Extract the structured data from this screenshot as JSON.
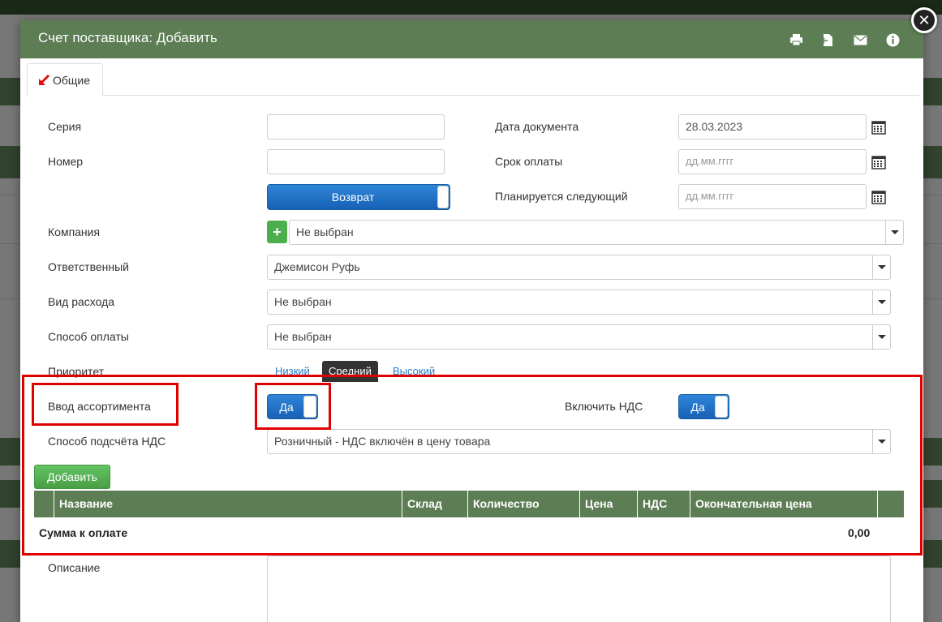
{
  "modal": {
    "title": "Счет поставщика: Добавить",
    "header_icons": [
      "print-icon",
      "export-icon",
      "mail-icon",
      "info-icon"
    ],
    "close_label": "✕"
  },
  "tabs": [
    {
      "label": "Общие",
      "active": true
    }
  ],
  "form": {
    "series": {
      "label": "Серия",
      "value": ""
    },
    "number": {
      "label": "Номер",
      "value": ""
    },
    "return_button": "Возврат",
    "doc_date": {
      "label": "Дата документа",
      "value": "28.03.2023"
    },
    "due_date": {
      "label": "Срок оплаты",
      "placeholder": "дд.мм.гггг"
    },
    "next_planned": {
      "label": "Планируется следующий",
      "placeholder": "дд.мм.гггг"
    },
    "company": {
      "label": "Компания",
      "value": "Не выбран"
    },
    "responsible": {
      "label": "Ответственный",
      "value": "Джемисон Руфь"
    },
    "expense_type": {
      "label": "Вид расхода",
      "value": "Не выбран"
    },
    "payment_method": {
      "label": "Способ оплаты",
      "value": "Не выбран"
    },
    "priority": {
      "label": "Приоритет",
      "options": [
        "Низкий",
        "Средний",
        "Высокий"
      ],
      "selected": "Средний"
    },
    "assortment": {
      "label": "Ввод ассортимента",
      "toggle": "Да"
    },
    "vat_include": {
      "label": "Включить НДС",
      "toggle": "Да"
    },
    "vat_method": {
      "label": "Способ подсчёта НДС",
      "value": "Розничный - НДС включён в цену товара"
    },
    "add_button": "Добавить",
    "description": {
      "label": "Описание",
      "value": ""
    }
  },
  "table": {
    "columns": [
      "Название",
      "Склад",
      "Количество",
      "Цена",
      "НДС",
      "Окончательная цена"
    ],
    "rows": [],
    "total_label": "Сумма к оплате",
    "total_value": "0,00"
  },
  "colors": {
    "header_green": "#5d7d54",
    "toggle_blue": "#1760b5",
    "highlight_red": "#e00000",
    "add_green": "#4cae4c"
  }
}
